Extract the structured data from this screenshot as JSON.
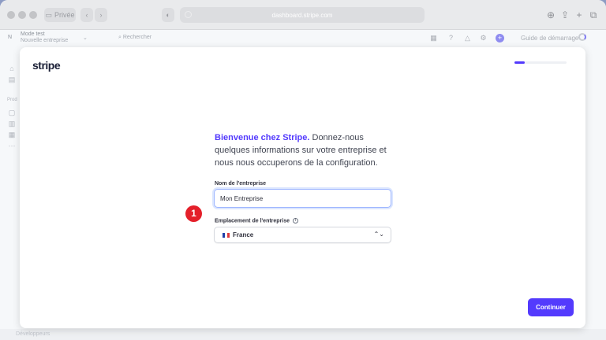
{
  "browser": {
    "private_label": "Privée",
    "url": "dashboard.stripe.com"
  },
  "dashboard": {
    "account_initial": "N",
    "account_mode": "Mode test",
    "account_name": "Nouvelle entreprise",
    "search_placeholder": "Rechercher",
    "guide_label": "Guide de démarrage",
    "sidebar_section": "Prod",
    "bottom_text": "Développeurs"
  },
  "modal": {
    "logo": "stripe",
    "progress_fraction": 0.2,
    "intro_accent": "Bienvenue chez Stripe.",
    "intro_rest": " Donnez-nous quelques informations sur votre entreprise et nous nous occuperons de la configuration.",
    "name_label": "Nom de l'entreprise",
    "name_value": "Mon Entreprise",
    "location_label": "Emplacement de l'entreprise",
    "location_value": "France",
    "continue_label": "Continuer"
  },
  "annotation": {
    "step_number": "1"
  },
  "colors": {
    "accent": "#533afd",
    "marker": "#e4202a"
  }
}
